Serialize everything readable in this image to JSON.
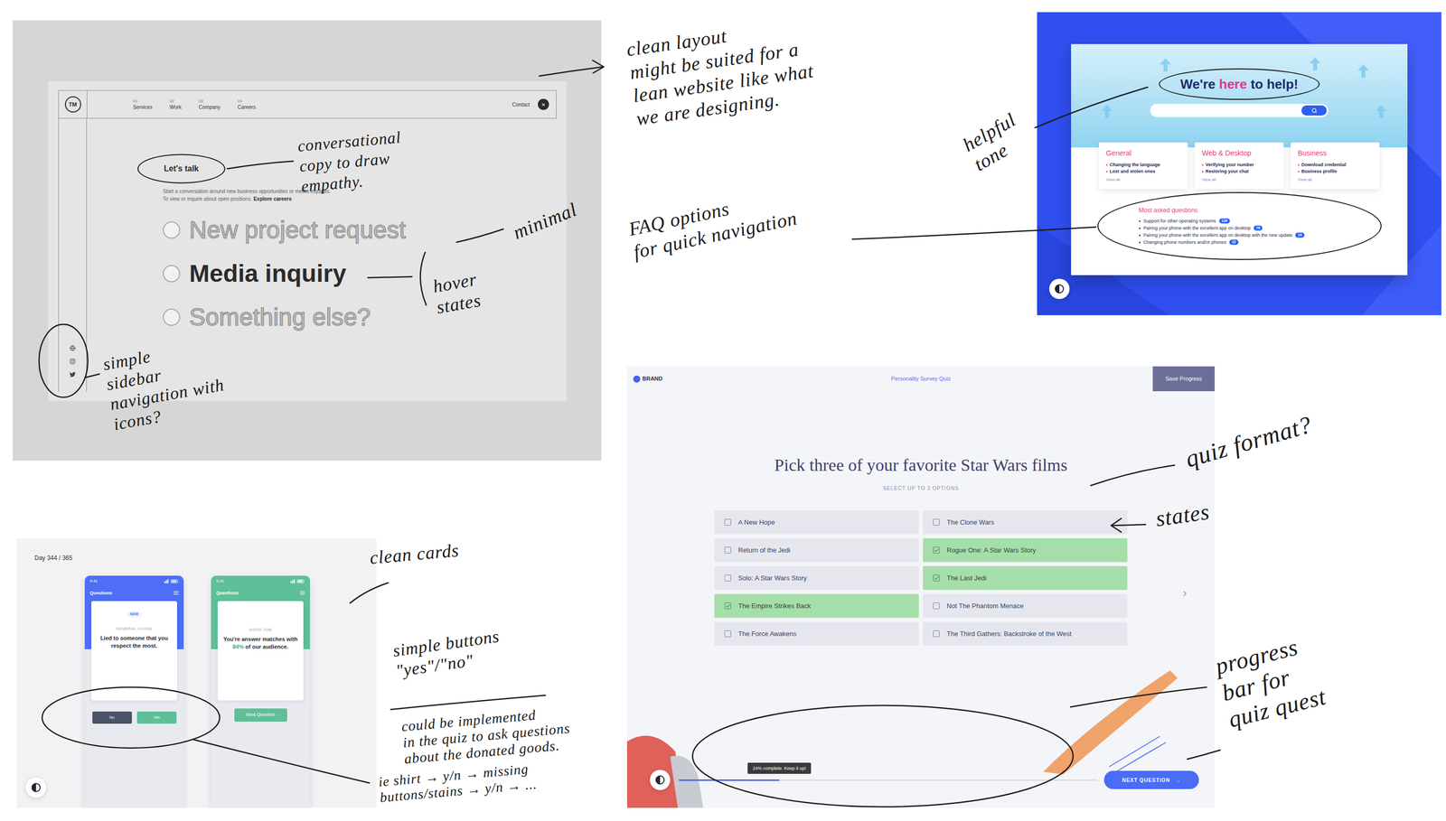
{
  "contact_page": {
    "logo": "TM",
    "nav": [
      {
        "number": "01",
        "label": "Services"
      },
      {
        "number": "02",
        "label": "Work"
      },
      {
        "number": "03",
        "label": "Company"
      },
      {
        "number": "04",
        "label": "Careers"
      }
    ],
    "contact": {
      "label": "Contact",
      "icon": "×"
    },
    "intro": {
      "title": "Let's talk",
      "line": "Start a conversation around new business opportunities or media inquiries.",
      "tail": "To view or inquire about open positions.",
      "link": "Explore careers"
    },
    "options": [
      {
        "label": "New project request",
        "hovered": false
      },
      {
        "label": "Media inquiry",
        "hovered": true
      },
      {
        "label": "Something else?",
        "hovered": false
      }
    ]
  },
  "help_page": {
    "heading": {
      "before": "We're ",
      "highlight": "here",
      "after": " to help!"
    },
    "categories": [
      {
        "title": "General",
        "links": [
          "Changing the language",
          "Lost and stolen ones"
        ],
        "more": "View all"
      },
      {
        "title": "Web & Desktop",
        "links": [
          "Verifying your number",
          "Restoring your chat"
        ],
        "more": "View all"
      },
      {
        "title": "Business",
        "links": [
          "Download credential",
          "Business profile"
        ],
        "more": "View all"
      }
    ],
    "faq": {
      "title": "Most asked questions",
      "items": [
        {
          "text": "Support for other operating systems",
          "badge": "120"
        },
        {
          "text": "Pairing your phone with the excellent app on desktop",
          "badge": "78"
        },
        {
          "text": "Pairing your phone with the excellent app on desktop with the new update",
          "badge": "24"
        },
        {
          "text": "Changing phone numbers and/or phones",
          "badge": "22"
        }
      ]
    }
  },
  "quiz_cards": {
    "day": "Day 344 / 365",
    "phones": [
      {
        "kind": "question",
        "time": "9:41",
        "header": "Questions",
        "color": "#4d6ef5",
        "tag": "NEW",
        "category": "GENERAL LIVING",
        "text": "Lied to someone that you respect the most.",
        "buttons": [
          "No",
          "Yes"
        ]
      },
      {
        "kind": "result",
        "time": "9:41",
        "header": "Questions",
        "color": "#5fbf98",
        "category": "GOOD JOB",
        "before": "You're answer matches with ",
        "highlight": "84%",
        "after": " of our audience.",
        "button": "Next Question"
      }
    ]
  },
  "quiz": {
    "brand": "BRAND",
    "title": "Personality Survey Quiz",
    "save": "Save Progress",
    "question": "Pick three of your favorite Star Wars films",
    "hint": "SELECT UP TO 3 OPTIONS",
    "options": [
      {
        "label": "A New Hope",
        "selected": false
      },
      {
        "label": "The Clone Wars",
        "selected": false
      },
      {
        "label": "Return of the Jedi",
        "selected": false
      },
      {
        "label": "Rogue One: A Star Wars Story",
        "selected": true
      },
      {
        "label": "Solo: A Star Wars Story",
        "selected": false
      },
      {
        "label": "The Last Jedi",
        "selected": true
      },
      {
        "label": "The Empire Strikes Back",
        "selected": true
      },
      {
        "label": "Not The Phantom Menace",
        "selected": false
      },
      {
        "label": "The Force Awakens",
        "selected": false
      },
      {
        "label": "The Third Gathers: Backstroke of the West",
        "selected": false
      }
    ],
    "pager": "›",
    "progress": {
      "level": 0.24,
      "label": "24% complete. Keep it up!"
    },
    "next": {
      "label": "NEXT QUESTION",
      "icon": "→"
    }
  },
  "annotations": [
    {
      "lines": [
        "clean layout",
        "might be suited for a",
        "lean website like what",
        "we are designing."
      ]
    },
    {
      "lines": [
        "helpful",
        "tone"
      ]
    },
    {
      "lines": [
        "FAQ options",
        "for quick navigation"
      ]
    },
    {
      "lines": [
        "conversational",
        "copy to draw",
        "empathy."
      ]
    },
    {
      "lines": [
        "minimal"
      ]
    },
    {
      "lines": [
        "hover",
        "states"
      ]
    },
    {
      "lines": [
        "simple",
        "sidebar",
        "navigation with",
        "icons?"
      ]
    },
    {
      "lines": [
        "clean cards"
      ]
    },
    {
      "lines": [
        "simple buttons",
        "\"yes\"/\"no\""
      ]
    },
    {
      "lines": [
        "could be implemented",
        "in the quiz to ask questions",
        "about the donated goods."
      ]
    },
    {
      "lines": [
        "ie shirt → y/n → missing",
        "buttons/stains → y/n → ..."
      ]
    },
    {
      "lines": [
        "quiz format?"
      ]
    },
    {
      "lines": [
        "states"
      ]
    },
    {
      "lines": [
        "progress",
        "bar for",
        "quiz quest"
      ]
    }
  ]
}
